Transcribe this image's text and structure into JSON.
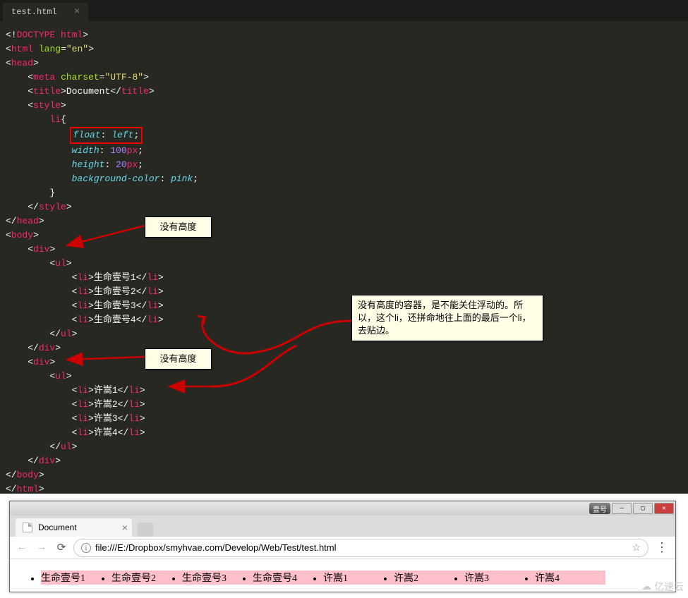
{
  "tab": {
    "filename": "test.html"
  },
  "code": {
    "doctype": "DOCTYPE html",
    "html_tag": "html",
    "html_attr": "lang",
    "html_val": "\"en\"",
    "head": "head",
    "meta": "meta",
    "meta_attr": "charset",
    "meta_val": "\"UTF-8\"",
    "title": "title",
    "title_text": "Document",
    "style": "style",
    "selector": "li",
    "prop_float": "float",
    "val_float": "left",
    "prop_width": "width",
    "val_width": "100",
    "val_px": "px",
    "prop_height": "height",
    "val_height": "20",
    "prop_bg": "background-color",
    "val_bg": "pink",
    "body": "body",
    "div": "div",
    "ul": "ul",
    "li": "li",
    "li_items1": [
      "生命壹号1",
      "生命壹号2",
      "生命壹号3",
      "生命壹号4"
    ],
    "li_items2": [
      "许嵩1",
      "许嵩2",
      "许嵩3",
      "许嵩4"
    ]
  },
  "callouts": {
    "no_height": "没有高度",
    "explain": "没有高度的容器，是不能关住浮动的。所以，这个li，还拼命地往上面的最后一个li，去贴边。"
  },
  "browser": {
    "tab_title": "Document",
    "url": "file:///E:/Dropbox/smyhvae.com/Develop/Web/Test/test.html",
    "items": [
      "生命壹号1",
      "生命壹号2",
      "生命壹号3",
      "生命壹号4",
      "许嵩1",
      "许嵩2",
      "许嵩3",
      "许嵩4"
    ],
    "badge": "壹号"
  },
  "watermark": "亿速云"
}
